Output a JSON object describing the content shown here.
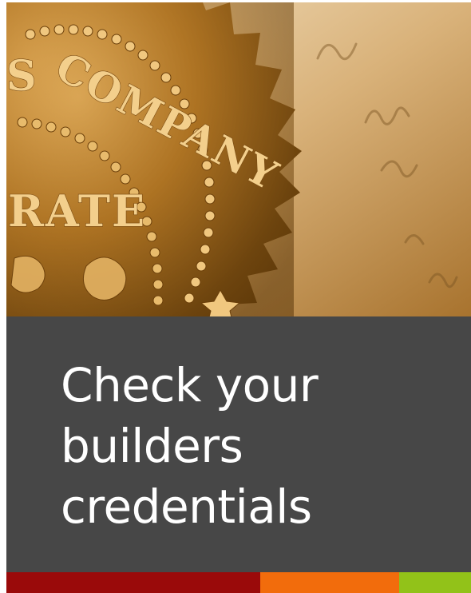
{
  "cover": {
    "title_lines": [
      "Check your",
      "builders",
      "credentials"
    ]
  },
  "photo": {
    "description_icon": "gold-embossed-corporate-seal",
    "seal_text": {
      "word1": "COMPANY",
      "word2": "RATE",
      "fragment": "S"
    }
  },
  "colors": {
    "panel": "#474747",
    "stripe_red": "#9a0a0a",
    "stripe_orange": "#f26c0c",
    "stripe_green": "#92c219"
  }
}
